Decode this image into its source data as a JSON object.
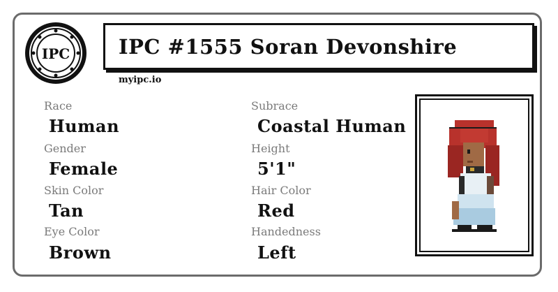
{
  "header": {
    "seal_text": "IPC",
    "title": "IPC #1555 Soran Devonshire",
    "site": "myipc.io"
  },
  "fields": {
    "race": {
      "label": "Race",
      "value": "Human"
    },
    "subrace": {
      "label": "Subrace",
      "value": "Coastal Human"
    },
    "gender": {
      "label": "Gender",
      "value": "Female"
    },
    "height": {
      "label": "Height",
      "value": "5'1\""
    },
    "skin_color": {
      "label": "Skin Color",
      "value": "Tan"
    },
    "hair_color": {
      "label": "Hair Color",
      "value": "Red"
    },
    "eye_color": {
      "label": "Eye Color",
      "value": "Brown"
    },
    "handedness": {
      "label": "Handedness",
      "value": "Left"
    }
  },
  "colors": {
    "border": "#6b6b6b",
    "label": "#7a7a7a",
    "text": "#111111",
    "hair": "#b8322c",
    "skin": "#a06a45",
    "dress": "#cfe3ef"
  }
}
